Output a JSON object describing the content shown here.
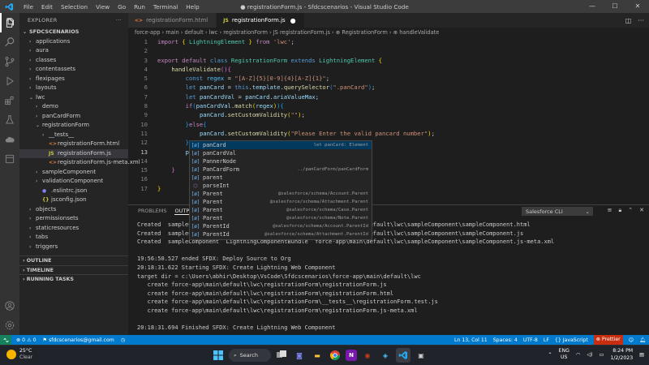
{
  "window": {
    "title": "● registrationForm.js - Sfdcscenarios - Visual Studio Code",
    "menu": [
      "File",
      "Edit",
      "Selection",
      "View",
      "Go",
      "Run",
      "Terminal",
      "Help"
    ]
  },
  "sidebar": {
    "title": "EXPLORER",
    "project": "SFDCSCENARIOS",
    "tree": [
      {
        "label": "applications",
        "depth": 1,
        "chev": "›",
        "selected": false
      },
      {
        "label": "aura",
        "depth": 1,
        "chev": "›",
        "selected": false
      },
      {
        "label": "classes",
        "depth": 1,
        "chev": "›",
        "selected": false
      },
      {
        "label": "contentassets",
        "depth": 1,
        "chev": "›",
        "selected": false
      },
      {
        "label": "flexipages",
        "depth": 1,
        "chev": "›",
        "selected": false
      },
      {
        "label": "layouts",
        "depth": 1,
        "chev": "›",
        "selected": false
      },
      {
        "label": "lwc",
        "depth": 1,
        "chev": "⌄",
        "selected": false
      },
      {
        "label": "demo",
        "depth": 2,
        "chev": "›",
        "selected": false
      },
      {
        "label": "panCardForm",
        "depth": 2,
        "chev": "›",
        "selected": false
      },
      {
        "label": "registrationForm",
        "depth": 2,
        "chev": "⌄",
        "selected": false
      },
      {
        "label": "__tests__",
        "depth": 3,
        "chev": "›",
        "selected": false
      },
      {
        "label": "registrationForm.html",
        "depth": 3,
        "chev": "",
        "icon": "<>",
        "iconColor": "#e37933",
        "selected": false
      },
      {
        "label": "registrationForm.js",
        "depth": 3,
        "chev": "",
        "icon": "JS",
        "iconColor": "#cbcb41",
        "selected": true
      },
      {
        "label": "registrationForm.js-meta.xml",
        "depth": 3,
        "chev": "",
        "icon": "<>",
        "iconColor": "#e37933",
        "selected": false
      },
      {
        "label": "sampleComponent",
        "depth": 2,
        "chev": "›",
        "selected": false
      },
      {
        "label": "validationComponent",
        "depth": 2,
        "chev": "›",
        "selected": false
      },
      {
        "label": ".eslintrc.json",
        "depth": 2,
        "chev": "",
        "icon": "●",
        "iconColor": "#8080f2",
        "selected": false
      },
      {
        "label": "jsconfig.json",
        "depth": 2,
        "chev": "",
        "icon": "{}",
        "iconColor": "#cbcb41",
        "selected": false
      },
      {
        "label": "objects",
        "depth": 1,
        "chev": "›",
        "selected": false
      },
      {
        "label": "permissionsets",
        "depth": 1,
        "chev": "›",
        "selected": false
      },
      {
        "label": "staticresources",
        "depth": 1,
        "chev": "›",
        "selected": false
      },
      {
        "label": "tabs",
        "depth": 1,
        "chev": "›",
        "selected": false
      },
      {
        "label": "triggers",
        "depth": 1,
        "chev": "›",
        "selected": false
      }
    ],
    "sections": [
      "OUTLINE",
      "TIMELINE",
      "RUNNING TASKS"
    ]
  },
  "tabs": [
    {
      "label": "registrationForm.html",
      "icon": "<>",
      "iconColor": "#e37933",
      "active": false,
      "dirty": false
    },
    {
      "label": "registrationForm.js",
      "icon": "JS",
      "iconColor": "#cbcb41",
      "active": true,
      "dirty": true
    }
  ],
  "breadcrumb": "force-app › main › default › lwc › registrationForm › JS registrationForm.js › ⊕ RegistrationForm › ⊕ handleValidate",
  "code": [
    {
      "n": "1",
      "html": "<span class='kw'>import</span> <span class='brk'>{</span> <span class='cls'>LightningElement</span> <span class='brk'>}</span> <span class='kw'>from</span> <span class='str'>'lwc'</span><span class='pun'>;</span>"
    },
    {
      "n": "2",
      "html": ""
    },
    {
      "n": "3",
      "html": "<span class='kw'>export</span> <span class='kw'>default</span> <span class='kw2'>class</span> <span class='cls'>RegistrationForm</span> <span class='kw2'>extends</span> <span class='cls'>LightningElement</span> <span class='brk'>{</span>"
    },
    {
      "n": "4",
      "html": "    <span class='fn'>handleValidate</span><span class='brk2'>()</span><span class='brk2'>{</span>"
    },
    {
      "n": "5",
      "html": "        <span class='kw2'>const</span> <span class='cst'>regex</span> <span class='pun'>=</span> <span class='str'>\"[A-Z]{5}[0-9]{4}[A-Z]{1}\"</span><span class='pun'>;</span>"
    },
    {
      "n": "6",
      "html": "        <span class='kw2'>let</span> <span class='var'>panCard</span> <span class='pun'>=</span> <span class='kw2'>this</span><span class='pun'>.</span><span class='var'>template</span><span class='pun'>.</span><span class='fn'>querySelector</span><span class='brk3'>(</span><span class='str'>\".panCard\"</span><span class='brk3'>)</span><span class='pun'>;</span>"
    },
    {
      "n": "7",
      "html": "        <span class='kw2'>let</span> <span class='var'>panCardVal</span> <span class='pun'>=</span> <span class='var'>panCard</span><span class='pun'>.</span><span class='var'>ariaValueMax</span><span class='pun'>;</span>"
    },
    {
      "n": "8",
      "html": "        <span class='kw'>if</span><span class='brk3'>(</span><span class='var'>panCardVal</span><span class='pun'>.</span><span class='fn'>match</span><span class='brk'>(</span><span class='var'>regex</span><span class='brk'>)</span><span class='brk3'>)</span><span class='brk3'>{</span>"
    },
    {
      "n": "9",
      "html": "            <span class='var'>panCard</span><span class='pun'>.</span><span class='fn'>setCustomValidity</span><span class='brk'>(</span><span class='str'>\"\"</span><span class='brk'>)</span><span class='pun'>;</span>"
    },
    {
      "n": "10",
      "html": "        <span class='brk3'>}</span><span class='kw'>else</span><span class='brk3'>{</span>"
    },
    {
      "n": "11",
      "html": "            <span class='var'>panCard</span><span class='pun'>.</span><span class='fn'>setCustomValidity</span><span class='brk'>(</span><span class='str'>\"Please Enter the valid pancard number\"</span><span class='brk'>)</span><span class='pun'>;</span>"
    },
    {
      "n": "12",
      "html": "        <span class='brk3'>}</span>"
    },
    {
      "n": "13",
      "html": "        <span class='var'>pan</span>",
      "current": true
    },
    {
      "n": "14",
      "html": ""
    },
    {
      "n": "15",
      "html": "    <span class='brk2'>}</span>"
    },
    {
      "n": "16",
      "html": ""
    },
    {
      "n": "17",
      "html": "<span class='brk'>}</span>"
    }
  ],
  "suggestions": [
    {
      "icon": "[ø]",
      "label": "panCard",
      "detail": "let panCard: Element",
      "selected": true
    },
    {
      "icon": "[ø]",
      "label": "panCardVal",
      "detail": "",
      "selected": false
    },
    {
      "icon": "[ø]",
      "label": "PannerNode",
      "detail": "",
      "selected": false
    },
    {
      "icon": "[ø]",
      "label": "PanCardForm",
      "detail": "../panCardForm/panCardForm",
      "selected": false
    },
    {
      "icon": "[ø]",
      "label": "parent",
      "detail": "",
      "selected": false
    },
    {
      "icon": "⬡",
      "label": "parseInt",
      "detail": "",
      "selected": false,
      "fn": true
    },
    {
      "icon": "[ø]",
      "label": "Parent",
      "detail": "@salesforce/schema/Account.Parent",
      "selected": false
    },
    {
      "icon": "[ø]",
      "label": "Parent",
      "detail": "@salesforce/schema/Attachment.Parent",
      "selected": false
    },
    {
      "icon": "[ø]",
      "label": "Parent",
      "detail": "@salesforce/schema/Case.Parent",
      "selected": false
    },
    {
      "icon": "[ø]",
      "label": "Parent",
      "detail": "@salesforce/schema/Note.Parent",
      "selected": false
    },
    {
      "icon": "[ø]",
      "label": "ParentId",
      "detail": "@salesforce/schema/Account.ParentId",
      "selected": false
    },
    {
      "icon": "[ø]",
      "label": "ParentId",
      "detail": "@salesforce/schema/Attachment.ParentId",
      "selected": false
    }
  ],
  "panel": {
    "tabs": [
      "PROBLEMS",
      "OUTPUT",
      "DEBUG CONSOLE",
      "TERMINAL"
    ],
    "active_tab": 1,
    "channel": "Salesforce CLI",
    "lines": [
      "Created  sampleComponent  LightningComponentBundle  force-app\\main\\default\\lwc\\sampleComponent\\sampleComponent.html",
      "Created  sampleComponent  LightningComponentBundle  force-app\\main\\default\\lwc\\sampleComponent\\sampleComponent.js",
      "Created  sampleComponent  LightningComponentBundle  force-app\\main\\default\\lwc\\sampleComponent\\sampleComponent.js-meta.xml",
      "",
      "19:56:50.527 ended SFDX: Deploy Source to Org",
      "20:18:31.622 Starting SFDX: Create Lightning Web Component",
      "target dir = c:\\Users\\abhir\\Desktop\\VsCode\\Sfdcscenarios\\force-app\\main\\default\\lwc",
      "   create force-app\\main\\default\\lwc\\registrationForm\\registrationForm.js",
      "   create force-app\\main\\default\\lwc\\registrationForm\\registrationForm.html",
      "   create force-app\\main\\default\\lwc\\registrationForm\\__tests__\\registrationForm.test.js",
      "   create force-app\\main\\default\\lwc\\registrationForm\\registrationForm.js-meta.xml",
      "",
      "20:18:31.694 Finished SFDX: Create Lightning Web Component"
    ]
  },
  "statusbar": {
    "errors": "0",
    "warnings": "0",
    "user": "sfdcscenarios@gmail.com",
    "position": "Ln 13, Col 11",
    "spaces": "Spaces: 4",
    "encoding": "UTF-8",
    "eol": "LF",
    "language": "JavaScript",
    "prettier": "Prettier"
  },
  "taskbar": {
    "temp": "25°C",
    "condition": "Clear",
    "search": "Search",
    "lang1": "ENG",
    "lang2": "US",
    "time": "8:24 PM",
    "date": "1/2/2023"
  },
  "colors": {
    "accent": "#007acc",
    "selection": "#04395e"
  }
}
